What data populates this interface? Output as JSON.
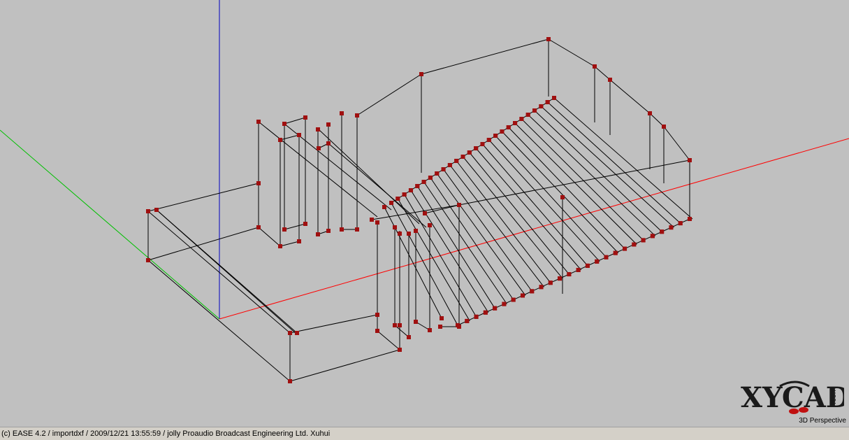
{
  "status_bar": {
    "text": "(c) EASE 4.2  / importdxf  / 2009/12/21 13:55:59 / jolly Proaudio Broadcast Engineering Ltd. Xuhui"
  },
  "logo": {
    "brand": "XYCAD",
    "suffix": ".com"
  },
  "view": {
    "mode_label": "3D Perspective"
  },
  "colors": {
    "background": "#c0c0c0",
    "wire": "#000000",
    "vertex": "#a01010",
    "axis_x": "#ff0000",
    "axis_y": "#00c000",
    "axis_z": "#0000c0",
    "statusbar": "#d4d0c8"
  }
}
